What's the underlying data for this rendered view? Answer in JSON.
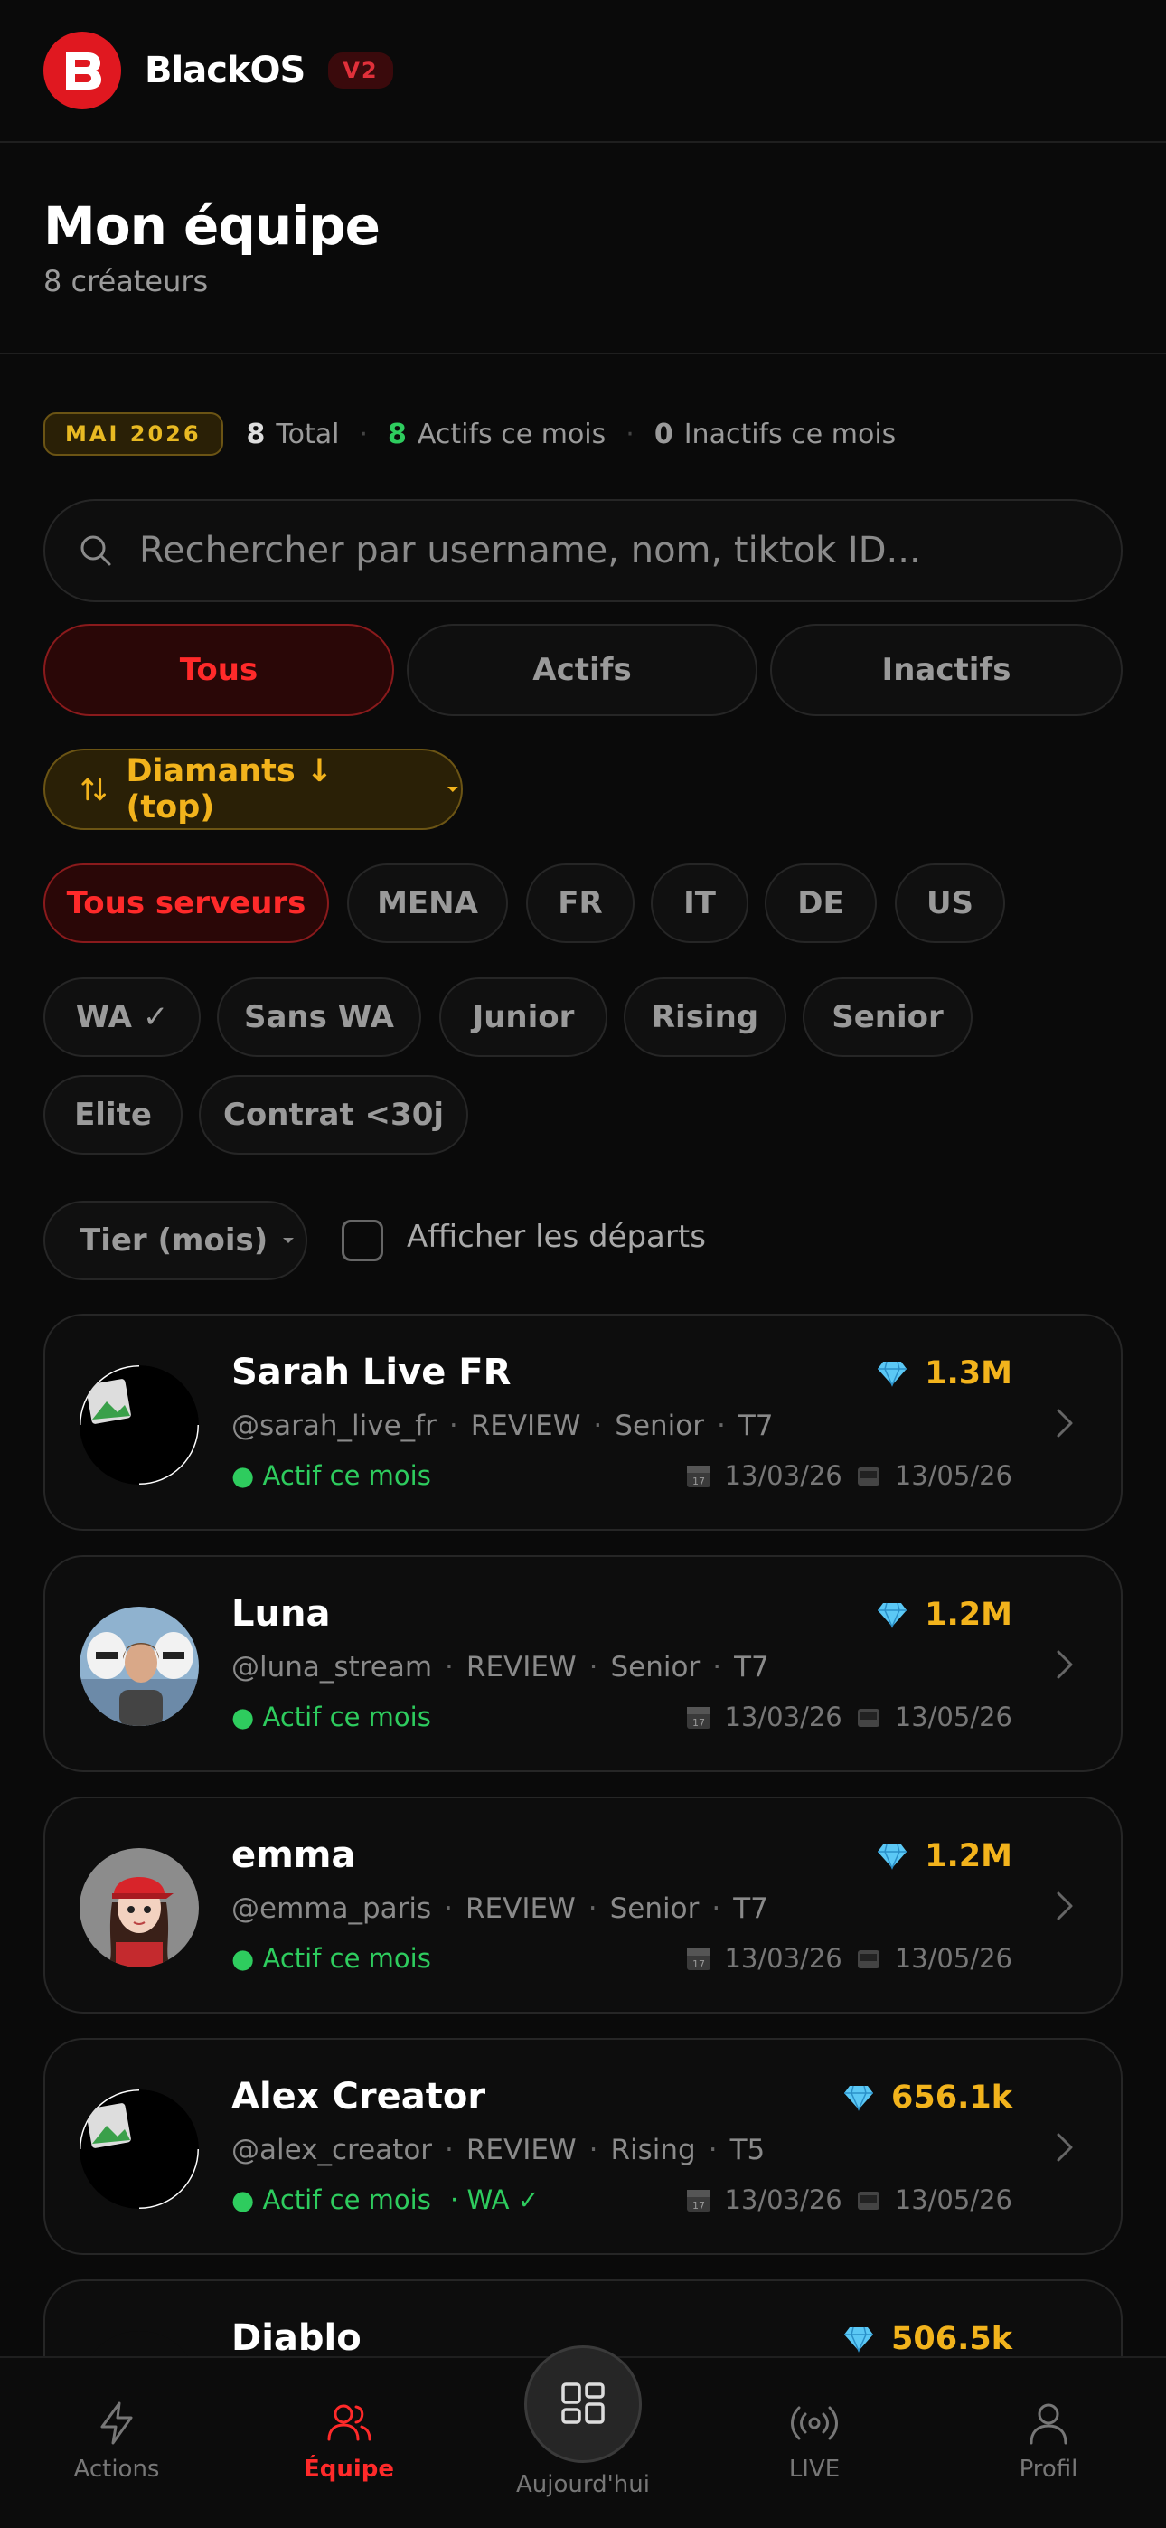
{
  "app": {
    "brand": "BlackOS",
    "version": "V2",
    "logo_letter": "B",
    "accent": "#e01820",
    "gold": "#f2b31c",
    "green": "#2ecc5e"
  },
  "header": {
    "title": "Mon équipe",
    "subtitle": "8 créateurs"
  },
  "stats": {
    "month": "MAI 2026",
    "total_num": "8",
    "total_label": "Total",
    "active_num": "8",
    "active_label": "Actifs ce mois",
    "inactive_num": "0",
    "inactive_label": "Inactifs ce mois"
  },
  "search": {
    "placeholder": "Rechercher par username, nom, tiktok ID..."
  },
  "segments": [
    {
      "label": "Tous",
      "active": true
    },
    {
      "label": "Actifs"
    },
    {
      "label": "Inactifs"
    }
  ],
  "sort": {
    "label": "Diamants ↓ (top)"
  },
  "servers": [
    {
      "label": "Tous serveurs",
      "active": true
    },
    {
      "label": "MENA"
    },
    {
      "label": "FR"
    },
    {
      "label": "IT"
    },
    {
      "label": "DE"
    },
    {
      "label": "US"
    }
  ],
  "filters": [
    {
      "label": "WA ✓"
    },
    {
      "label": "Sans WA"
    },
    {
      "label": "Junior"
    },
    {
      "label": "Rising"
    },
    {
      "label": "Senior"
    },
    {
      "label": "Elite"
    },
    {
      "label": "Contrat <30j"
    }
  ],
  "tier": {
    "label": "Tier (mois)"
  },
  "departs": {
    "label": "Afficher les départs",
    "checked": false
  },
  "creators": [
    {
      "name": "Sarah Live FR",
      "handle": "@sarah_live_fr",
      "stage": "REVIEW",
      "level": "Senior",
      "tier": "T7",
      "status": "● Actif ce mois",
      "wa": "",
      "diamonds": "1.3M",
      "date_start": "13/03/26",
      "date_end": "13/05/26",
      "avatar": "broken"
    },
    {
      "name": "Luna",
      "handle": "@luna_stream",
      "stage": "REVIEW",
      "level": "Senior",
      "tier": "T7",
      "status": "● Actif ce mois",
      "wa": "",
      "diamonds": "1.2M",
      "date_start": "13/03/26",
      "date_end": "13/05/26",
      "avatar": "photo"
    },
    {
      "name": "emma",
      "handle": "@emma_paris",
      "stage": "REVIEW",
      "level": "Senior",
      "tier": "T7",
      "status": "● Actif ce mois",
      "wa": "",
      "diamonds": "1.2M",
      "date_start": "13/03/26",
      "date_end": "13/05/26",
      "avatar": "cartoon"
    },
    {
      "name": "Alex Creator",
      "handle": "@alex_creator",
      "stage": "REVIEW",
      "level": "Rising",
      "tier": "T5",
      "status": "● Actif ce mois",
      "wa": "· WA ✓",
      "diamonds": "656.1k",
      "date_start": "13/03/26",
      "date_end": "13/05/26",
      "avatar": "broken"
    },
    {
      "name": "Diablo",
      "diamonds": "506.5k",
      "avatar": "tiger"
    }
  ],
  "tabs": [
    {
      "label": "Actions",
      "icon": "lightning-icon"
    },
    {
      "label": "Équipe",
      "icon": "users-icon",
      "active": true
    },
    {
      "label": "Aujourd'hui",
      "icon": "grid-icon"
    },
    {
      "label": "LIVE",
      "icon": "broadcast-icon"
    },
    {
      "label": "Profil",
      "icon": "user-icon"
    }
  ]
}
